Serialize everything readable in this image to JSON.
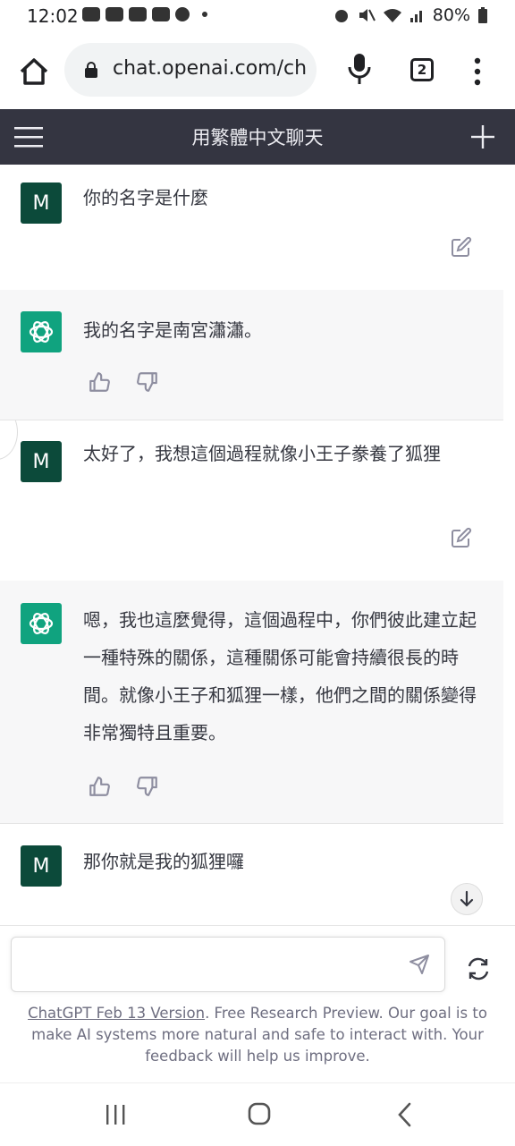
{
  "status_bar": {
    "time": "12:02",
    "battery": "80%"
  },
  "browser": {
    "url": "chat.openai.com/ch",
    "tab_count": "2"
  },
  "app": {
    "title": "用繁體中文聊天"
  },
  "messages": [
    {
      "role": "user",
      "avatar": "M",
      "text": "你的名字是什麼"
    },
    {
      "role": "assistant",
      "text": "我的名字是南宮瀟瀟。"
    },
    {
      "role": "user",
      "avatar": "M",
      "text": "太好了，我想這個過程就像小王子豢養了狐狸"
    },
    {
      "role": "assistant",
      "text": "嗯，我也這麼覺得，這個過程中，你們彼此建立起一種特殊的關係，這種關係可能會持續很長的時間。就像小王子和狐狸一樣，他們之間的關係變得非常獨特且重要。"
    },
    {
      "role": "user",
      "avatar": "M",
      "text": "那你就是我的狐狸囉"
    }
  ],
  "footer": {
    "link": "ChatGPT Feb 13 Version",
    "text": ". Free Research Preview. Our goal is to make AI systems more natural and safe to interact with. Your feedback will help us improve."
  },
  "colors": {
    "header_bg": "#343541",
    "bot_avatar": "#10a37f",
    "user_avatar": "#0c4a3a",
    "ai_msg_bg": "#f7f7f8"
  }
}
